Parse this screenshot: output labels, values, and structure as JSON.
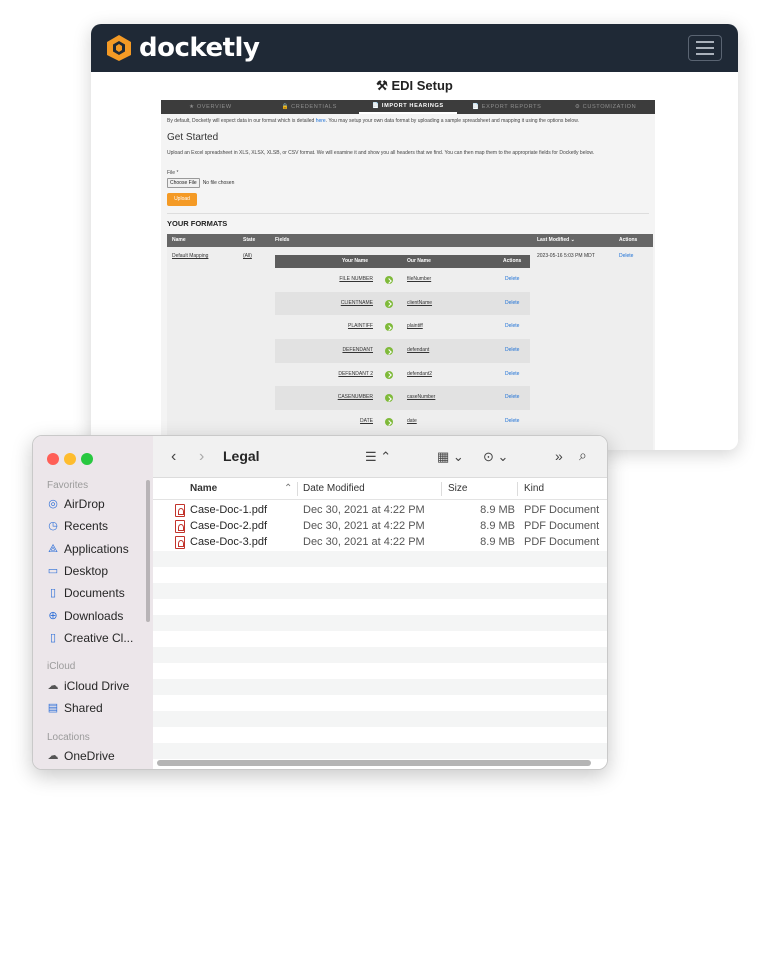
{
  "docketly": {
    "brand": "docketly",
    "page_title": "EDI Setup",
    "tabs": [
      {
        "label": "★ OVERVIEW"
      },
      {
        "label": "🔒 CREDENTIALS"
      },
      {
        "label": "📄 IMPORT HEARINGS"
      },
      {
        "label": "📄 EXPORT REPORTS"
      },
      {
        "label": "⚙ CUSTOMIZATION"
      }
    ],
    "intro_text_before": "By default, Docketly will expect data in our format which is detailed ",
    "intro_link": "here",
    "intro_text_after": ". You may setup your own data format by uploading a sample spreadsheet and mapping it using the options below.",
    "get_started": "Get Started",
    "upload_instructions": "Upload an Excel spreadsheet in XLS, XLSX, XLSB, or CSV format. We will examine it and show you all headers that we find. You can then map them to the appropriate fields for Docketly below.",
    "file_label": "File *",
    "choose_file": "Choose File",
    "no_file": "No file chosen",
    "upload_button": "Upload",
    "your_formats": "YOUR FORMATS",
    "format_columns": {
      "name": "Name",
      "state": "State",
      "fields": "Fields",
      "last_modified": "Last Modified ⌄",
      "actions": "Actions"
    },
    "format_row": {
      "name": "Default Mapping",
      "state": "(All)",
      "last_modified": "2023-05-16 5:03 PM MDT",
      "action": "Delete"
    },
    "mapping_columns": {
      "your_name": "Your Name",
      "our_name": "Our Name",
      "actions": "Actions"
    },
    "mappings": [
      {
        "your_name": "FILE NUMBER",
        "our_name": "fileNumber",
        "action": "Delete"
      },
      {
        "your_name": "CLIENTNAME",
        "our_name": "clientName",
        "action": "Delete"
      },
      {
        "your_name": "PLAINTIFF",
        "our_name": "plaintiff",
        "action": "Delete"
      },
      {
        "your_name": "DEFENDANT",
        "our_name": "defendant",
        "action": "Delete"
      },
      {
        "your_name": "DEFENDANT 2",
        "our_name": "defendant2",
        "action": "Delete"
      },
      {
        "your_name": "CASENUMBER",
        "our_name": "caseNumber",
        "action": "Delete"
      },
      {
        "your_name": "DATE",
        "our_name": "date",
        "action": "Delete"
      }
    ]
  },
  "finder": {
    "folder_title": "Legal",
    "sidebar": {
      "favorites_label": "Favorites",
      "favorites": [
        {
          "label": "AirDrop",
          "icon": "airdrop-icon"
        },
        {
          "label": "Recents",
          "icon": "clock-icon"
        },
        {
          "label": "Applications",
          "icon": "applications-icon"
        },
        {
          "label": "Desktop",
          "icon": "desktop-icon"
        },
        {
          "label": "Documents",
          "icon": "document-icon"
        },
        {
          "label": "Downloads",
          "icon": "download-icon"
        },
        {
          "label": "Creative Cl...",
          "icon": "file-icon"
        }
      ],
      "icloud_label": "iCloud",
      "icloud": [
        {
          "label": "iCloud Drive",
          "icon": "cloud-icon"
        },
        {
          "label": "Shared",
          "icon": "shared-folder-icon"
        }
      ],
      "locations_label": "Locations",
      "locations": [
        {
          "label": "OneDrive",
          "icon": "cloud-icon"
        }
      ]
    },
    "columns": {
      "name": "Name",
      "date_modified": "Date Modified",
      "size": "Size",
      "kind": "Kind"
    },
    "files": [
      {
        "name": "Case-Doc-1.pdf",
        "date": "Dec 30, 2021 at 4:22 PM",
        "size": "8.9 MB",
        "kind": "PDF Document"
      },
      {
        "name": "Case-Doc-2.pdf",
        "date": "Dec 30, 2021 at 4:22 PM",
        "size": "8.9 MB",
        "kind": "PDF Document"
      },
      {
        "name": "Case-Doc-3.pdf",
        "date": "Dec 30, 2021 at 4:22 PM",
        "size": "8.9 MB",
        "kind": "PDF Document"
      }
    ],
    "colors": {
      "close": "#ff5f57",
      "minimize": "#febc2e",
      "zoom": "#28c840",
      "accent": "#2d6fd8"
    }
  }
}
